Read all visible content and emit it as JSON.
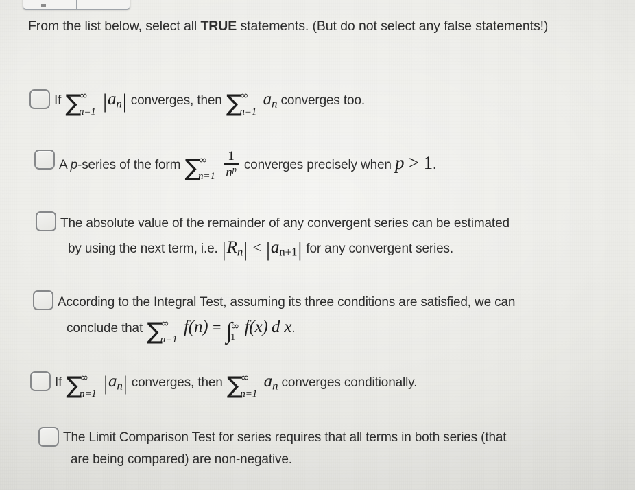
{
  "window": {
    "toolbar_fragment": {
      "visible": true,
      "cells": 2
    }
  },
  "question": {
    "prompt_part1": "From the list below, select all ",
    "prompt_emphasis": "TRUE",
    "prompt_part2": " statements. (But do not select any false statements!)",
    "checkbox_state": "unchecked"
  },
  "options": [
    {
      "id": "option-1",
      "checked": false,
      "plain_text": "If ∑_{n=1}^{∞} |a_n| converges, then ∑_{n=1}^{∞} a_n converges too.",
      "text_if": "If",
      "sum_lower": "n=1",
      "sum_upper": "∞",
      "a_n": "a",
      "a_n_sub": "n",
      "text_converges_then": "converges, then",
      "text_tail": "converges too."
    },
    {
      "id": "option-2",
      "checked": false,
      "plain_text": "A p-series of the form ∑_{n=1}^{∞} 1/n^p converges precisely when p > 1.",
      "text_lead": "A ",
      "text_p": "p",
      "text_series_of_form": "-series of the form",
      "sum_lower": "n=1",
      "sum_upper": "∞",
      "frac_num": "1",
      "frac_den": "n",
      "frac_den_exp": "p",
      "text_mid": "converges precisely when",
      "math_p": "p",
      "math_gt": ">",
      "math_one": "1",
      "text_period": "."
    },
    {
      "id": "option-3",
      "checked": false,
      "plain_text": "The absolute value of the remainder of any convergent series can be estimated by using the next term, i.e. |R_n| < |a_{n+1}| for any convergent series.",
      "line1": "The absolute value of the remainder of any convergent series can be estimated",
      "line2_lead": "by using the next term, i.e.",
      "math_R": "R",
      "math_R_sub": "n",
      "math_lt": "<",
      "math_a": "a",
      "math_a_sub": "n+1",
      "line2_tail": "for any convergent series."
    },
    {
      "id": "option-4",
      "checked": false,
      "plain_text": "According to the Integral Test, assuming its three conditions are satisfied, we can conclude that ∑_{n=1}^{∞} f(n) = ∫_1^{∞} f(x) d x.",
      "line1": "According to the Integral Test, assuming its three conditions are satisfied, we can",
      "line2_lead": "conclude that",
      "sum_lower": "n=1",
      "sum_upper": "∞",
      "math_fn": "f(n)",
      "math_eq": "=",
      "int_lower": "1",
      "int_upper": "∞",
      "math_fx": "f(x)",
      "math_dx": "d x",
      "text_period": "."
    },
    {
      "id": "option-5",
      "checked": false,
      "plain_text": "If ∑_{n=1}^{∞} |a_n| converges, then ∑_{n=1}^{∞} a_n converges conditionally.",
      "text_if": "If",
      "sum_lower": "n=1",
      "sum_upper": "∞",
      "a_n": "a",
      "a_n_sub": "n",
      "text_converges_then": "converges, then",
      "text_tail": "converges conditionally."
    },
    {
      "id": "option-6",
      "checked": false,
      "plain_text": "The Limit Comparison Test for series requires that all terms in both series (that are being compared) are non-negative.",
      "line1": "The Limit Comparison Test for series requires that all terms in both series (that",
      "line2": "are being compared) are non-negative."
    }
  ],
  "colors": {
    "background": "#e9e9e5",
    "text": "#2e2e2e",
    "math_text": "#1d1d1d",
    "checkbox_border": "#86888a",
    "checkbox_fill": "#eeeeea"
  }
}
